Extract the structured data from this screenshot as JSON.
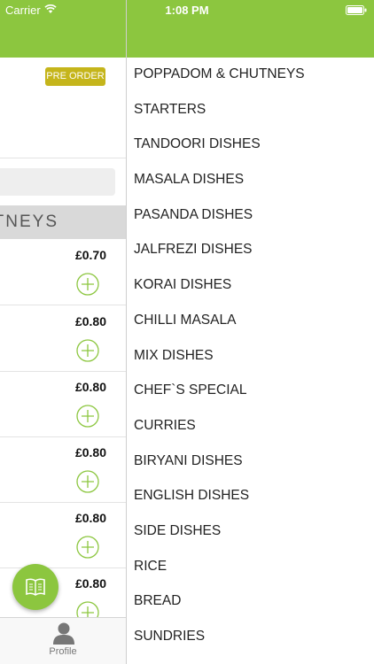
{
  "status_bar": {
    "carrier": "Carrier",
    "time": "1:08 PM"
  },
  "badge": {
    "preorder": "PRE ORDER"
  },
  "section": {
    "header": "POPPADOM & CHUTNEYS"
  },
  "items": [
    {
      "price": "£0.70"
    },
    {
      "price": "£0.80"
    },
    {
      "price": "£0.80"
    },
    {
      "price": "£0.80"
    },
    {
      "price": "£0.80"
    },
    {
      "price": "£0.80"
    }
  ],
  "tabbar": {
    "profile": "Profile"
  },
  "menu": [
    "POPPADOM & CHUTNEYS",
    "STARTERS",
    "TANDOORI DISHES",
    "MASALA DISHES",
    "PASANDA DISHES",
    "JALFREZI DISHES",
    "KORAI DISHES",
    "CHILLI MASALA",
    "MIX DISHES",
    "CHEF`S SPECIAL",
    "CURRIES",
    "BIRYANI DISHES",
    "ENGLISH DISHES",
    "SIDE DISHES",
    "RICE",
    "BREAD",
    "SUNDRIES"
  ],
  "colors": {
    "accent": "#8cc63f",
    "badge": "#c5b51b"
  }
}
